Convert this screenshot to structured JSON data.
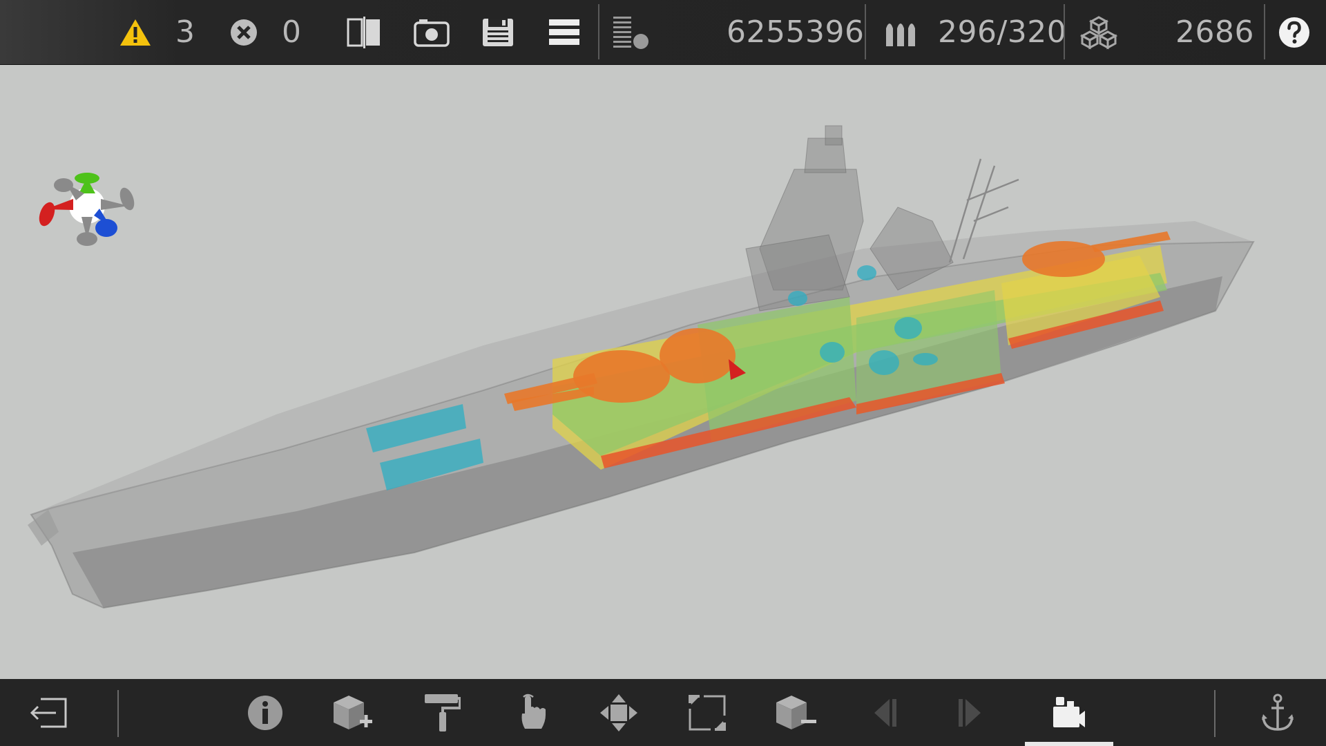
{
  "toolbar": {
    "warnings_count": "3",
    "errors_count": "0",
    "cost": "6255396",
    "ammo": "296/320",
    "blocks": "2686"
  },
  "icons": {
    "warning": "warning-icon",
    "error": "error-icon",
    "compare": "compare-icon",
    "screenshot": "camera-icon",
    "save": "save-icon",
    "menu": "menu-icon",
    "layers": "layers-icon",
    "ammo": "ammo-icon",
    "blocks": "blocks-icon",
    "help": "help-icon",
    "exit": "exit-icon",
    "info": "info-icon",
    "add_block": "add-block-icon",
    "paint": "paint-roller-icon",
    "select": "hand-pointer-icon",
    "move": "move-icon",
    "resize": "resize-icon",
    "remove_block": "remove-block-icon",
    "prev": "previous-icon",
    "next": "next-icon",
    "views": "views-icon",
    "anchor": "anchor-icon"
  },
  "colors": {
    "warning": "#f4c20d",
    "gizmo_x": "#d42020",
    "gizmo_y": "#4ec21a",
    "gizmo_z": "#1d4fd4",
    "hull": "#8e8e8e",
    "armor_orange": "#e8782a",
    "armor_yellow": "#e2d34a",
    "armor_green": "#8fc86a",
    "cyan": "#2eaec3"
  }
}
